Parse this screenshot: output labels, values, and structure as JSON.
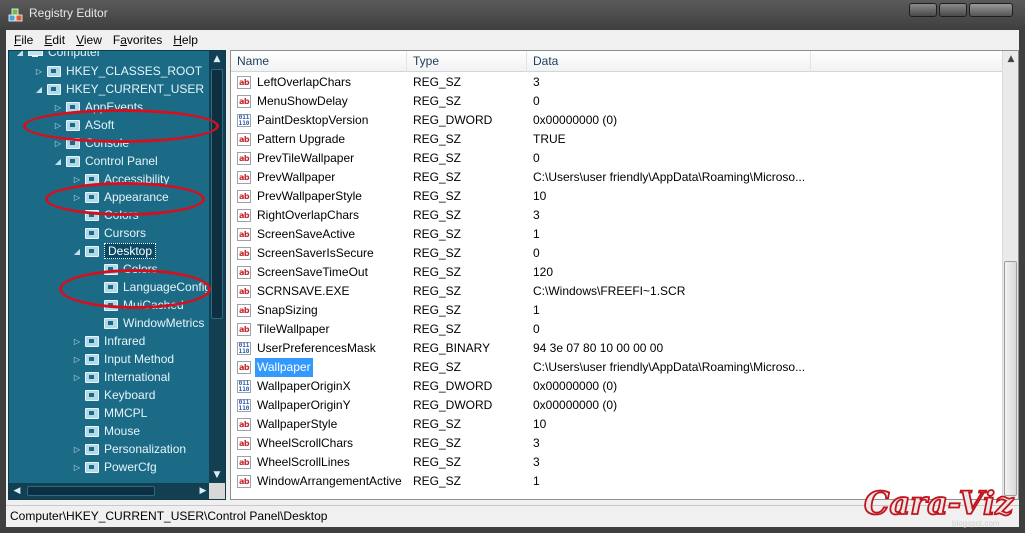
{
  "window": {
    "title": "Registry Editor"
  },
  "menu": [
    {
      "mnemonic": "F",
      "rest": "ile"
    },
    {
      "mnemonic": "E",
      "rest": "dit"
    },
    {
      "mnemonic": "V",
      "rest": "iew"
    },
    {
      "mnemonic": "",
      "pre": "F",
      "mid": "a",
      "rest": "vorites",
      "label": "Favorites"
    },
    {
      "mnemonic": "H",
      "rest": "elp"
    }
  ],
  "tree": {
    "nodes": [
      {
        "label": "Computer",
        "expanded": true,
        "icon": "computer-icon"
      },
      {
        "label": "HKEY_CLASSES_ROOT",
        "expanded": false,
        "icon": "folder-icon"
      },
      {
        "label": "HKEY_CURRENT_USER",
        "expanded": true,
        "icon": "folder-icon"
      },
      {
        "label": "AppEvents",
        "expanded": false,
        "icon": "folder-icon"
      },
      {
        "label": "ASoft",
        "expanded": false,
        "icon": "folder-icon"
      },
      {
        "label": "Console",
        "expanded": false,
        "icon": "folder-icon"
      },
      {
        "label": "Control Panel",
        "expanded": true,
        "icon": "folder-icon"
      },
      {
        "label": "Accessibility",
        "expanded": false,
        "icon": "folder-icon"
      },
      {
        "label": "Appearance",
        "expanded": false,
        "icon": "folder-icon"
      },
      {
        "label": "Colors",
        "expanded": null,
        "icon": "folder-icon"
      },
      {
        "label": "Cursors",
        "expanded": null,
        "icon": "folder-icon"
      },
      {
        "label": "Desktop",
        "expanded": true,
        "icon": "folder-icon",
        "selected": true
      },
      {
        "label": "Colors",
        "expanded": null,
        "icon": "folder-icon"
      },
      {
        "label": "LanguageConfiguration",
        "expanded": null,
        "icon": "folder-icon"
      },
      {
        "label": "MuiCached",
        "expanded": null,
        "icon": "folder-icon"
      },
      {
        "label": "WindowMetrics",
        "expanded": null,
        "icon": "folder-icon"
      },
      {
        "label": "Infrared",
        "expanded": false,
        "icon": "folder-icon"
      },
      {
        "label": "Input Method",
        "expanded": false,
        "icon": "folder-icon"
      },
      {
        "label": "International",
        "expanded": false,
        "icon": "folder-icon"
      },
      {
        "label": "Keyboard",
        "expanded": null,
        "icon": "folder-icon"
      },
      {
        "label": "MMCPL",
        "expanded": null,
        "icon": "folder-icon"
      },
      {
        "label": "Mouse",
        "expanded": null,
        "icon": "folder-icon"
      },
      {
        "label": "Personalization",
        "expanded": false,
        "icon": "folder-icon"
      },
      {
        "label": "PowerCfg",
        "expanded": false,
        "icon": "folder-icon"
      }
    ]
  },
  "list": {
    "columns": {
      "name": "Name",
      "type": "Type",
      "data": "Data"
    },
    "rows": [
      {
        "icon": "ab",
        "name": "LeftOverlapChars",
        "type": "REG_SZ",
        "data": "3"
      },
      {
        "icon": "ab",
        "name": "MenuShowDelay",
        "type": "REG_SZ",
        "data": "0"
      },
      {
        "icon": "bin",
        "name": "PaintDesktopVersion",
        "type": "REG_DWORD",
        "data": "0x00000000 (0)"
      },
      {
        "icon": "ab",
        "name": "Pattern Upgrade",
        "type": "REG_SZ",
        "data": "TRUE"
      },
      {
        "icon": "ab",
        "name": "PrevTileWallpaper",
        "type": "REG_SZ",
        "data": "0"
      },
      {
        "icon": "ab",
        "name": "PrevWallpaper",
        "type": "REG_SZ",
        "data": "C:\\Users\\user friendly\\AppData\\Roaming\\Microso..."
      },
      {
        "icon": "ab",
        "name": "PrevWallpaperStyle",
        "type": "REG_SZ",
        "data": "10"
      },
      {
        "icon": "ab",
        "name": "RightOverlapChars",
        "type": "REG_SZ",
        "data": "3"
      },
      {
        "icon": "ab",
        "name": "ScreenSaveActive",
        "type": "REG_SZ",
        "data": "1"
      },
      {
        "icon": "ab",
        "name": "ScreenSaverIsSecure",
        "type": "REG_SZ",
        "data": "0"
      },
      {
        "icon": "ab",
        "name": "ScreenSaveTimeOut",
        "type": "REG_SZ",
        "data": "120"
      },
      {
        "icon": "ab",
        "name": "SCRNSAVE.EXE",
        "type": "REG_SZ",
        "data": "C:\\Windows\\FREEFI~1.SCR"
      },
      {
        "icon": "ab",
        "name": "SnapSizing",
        "type": "REG_SZ",
        "data": "1"
      },
      {
        "icon": "ab",
        "name": "TileWallpaper",
        "type": "REG_SZ",
        "data": "0"
      },
      {
        "icon": "bin",
        "name": "UserPreferencesMask",
        "type": "REG_BINARY",
        "data": "94 3e 07 80 10 00 00 00"
      },
      {
        "icon": "ab",
        "name": "Wallpaper",
        "type": "REG_SZ",
        "data": "C:\\Users\\user friendly\\AppData\\Roaming\\Microso...",
        "selected": true
      },
      {
        "icon": "bin",
        "name": "WallpaperOriginX",
        "type": "REG_DWORD",
        "data": "0x00000000 (0)"
      },
      {
        "icon": "bin",
        "name": "WallpaperOriginY",
        "type": "REG_DWORD",
        "data": "0x00000000 (0)"
      },
      {
        "icon": "ab",
        "name": "WallpaperStyle",
        "type": "REG_SZ",
        "data": "10"
      },
      {
        "icon": "ab",
        "name": "WheelScrollChars",
        "type": "REG_SZ",
        "data": "3"
      },
      {
        "icon": "ab",
        "name": "WheelScrollLines",
        "type": "REG_SZ",
        "data": "3"
      },
      {
        "icon": "ab",
        "name": "WindowArrangementActive",
        "type": "REG_SZ",
        "data": "1"
      }
    ]
  },
  "status": {
    "path": "Computer\\HKEY_CURRENT_USER\\Control Panel\\Desktop"
  },
  "watermark": {
    "main": "Cara-Viz",
    "sub": "blogspot.com"
  },
  "colors": {
    "tree_bg": "#1c6b86",
    "highlight_ring": "#d4101e",
    "selection": "#3399ff"
  }
}
